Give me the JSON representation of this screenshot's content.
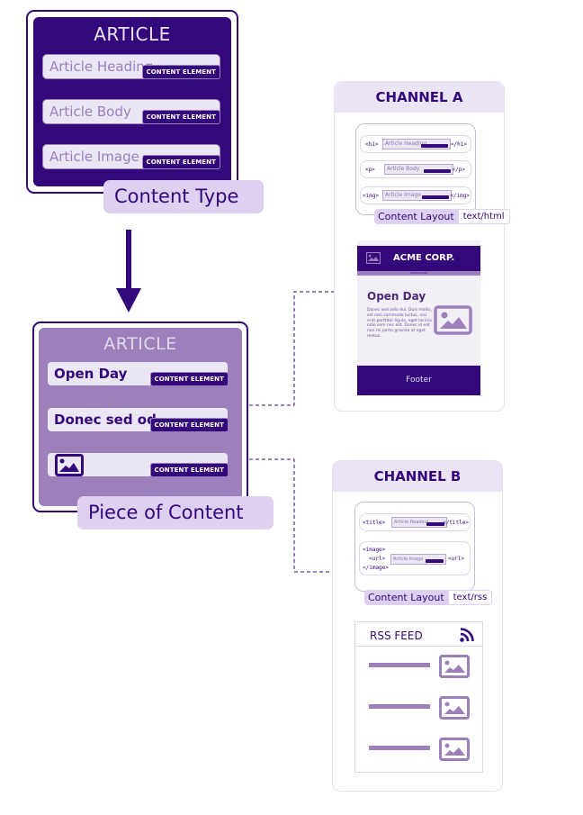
{
  "colors": {
    "primary": "#33087a",
    "secondary": "#9b80bb",
    "light": "#ebe4f4",
    "label_bg": "#ddd0f0"
  },
  "content_type": {
    "title": "ARTICLE",
    "fields": [
      {
        "label": "Article Heading",
        "badge": "CONTENT ELEMENT"
      },
      {
        "label": "Article Body",
        "badge": "CONTENT ELEMENT"
      },
      {
        "label": "Article Image",
        "badge": "CONTENT ELEMENT"
      }
    ],
    "caption": "Content Type"
  },
  "piece_of_content": {
    "title": "ARTICLE",
    "fields": [
      {
        "value": "Open Day",
        "badge": "CONTENT ELEMENT"
      },
      {
        "value": "Donec sed od...",
        "badge": "CONTENT ELEMENT"
      },
      {
        "icon": "image-icon",
        "badge": "CONTENT ELEMENT"
      }
    ],
    "caption": "Piece of Content"
  },
  "channel_a": {
    "title": "CHANNEL A",
    "layout_rows": [
      {
        "open": "<h1>",
        "field": "Article Heading",
        "close": "</h1>"
      },
      {
        "open": "<p>",
        "field": "Article Body",
        "close": "</p>"
      },
      {
        "open": "<img>",
        "field": "Article Image",
        "close": "</img>"
      }
    ],
    "layout_label": "Content Layout",
    "format": "text/html",
    "preview": {
      "brand": "ACME CORP.",
      "nav": "NAVIGATION",
      "heading": "Open Day",
      "body": "Donec sed odio dui. Duis mollis, est non commodo luctus, nisi erat porttitor ligula, eget lacinia odio sem nec elit. Donec id elit non mi porta gravida at eget metus.",
      "footer": "Footer"
    }
  },
  "channel_b": {
    "title": "CHANNEL B",
    "layout_rows": [
      {
        "open": "<title>",
        "field": "Article Heading",
        "close": "</title>"
      },
      {
        "open": "<image>",
        "inner_open": "<url>",
        "field": "Article Image",
        "inner_close": "<url>",
        "close": "</image>"
      }
    ],
    "layout_label": "Content Layout",
    "format": "text/rss",
    "preview": {
      "title": "RSS FEED",
      "items": 3
    }
  }
}
